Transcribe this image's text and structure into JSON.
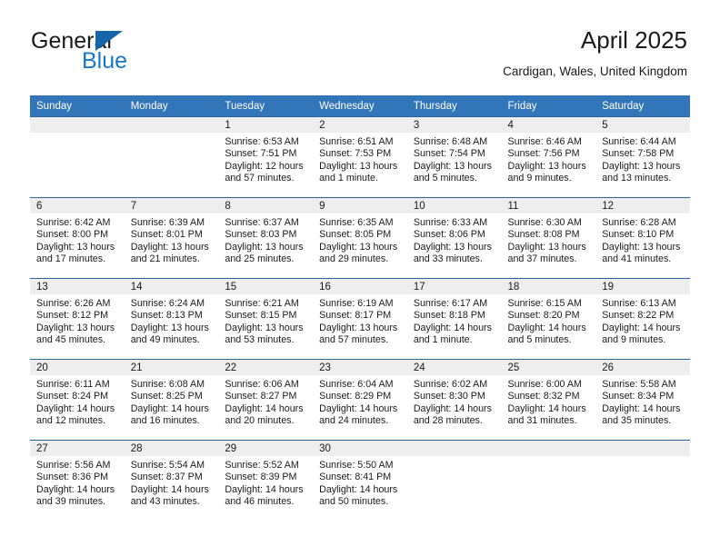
{
  "brand": {
    "name_part1": "General",
    "name_part2": "Blue",
    "accent_color": "#1878c8",
    "triangle_color": "#1565ac"
  },
  "header": {
    "title": "April 2025",
    "subtitle": "Cardigan, Wales, United Kingdom"
  },
  "theme": {
    "header_row_bg": "#3275b9",
    "cell_border": "#2b64a0",
    "daynum_band_bg": "#eeeeee"
  },
  "weekdays": [
    "Sunday",
    "Monday",
    "Tuesday",
    "Wednesday",
    "Thursday",
    "Friday",
    "Saturday"
  ],
  "weeks": [
    [
      {
        "day": "",
        "sunrise": "",
        "sunset": "",
        "daylight": ""
      },
      {
        "day": "",
        "sunrise": "",
        "sunset": "",
        "daylight": ""
      },
      {
        "day": "1",
        "sunrise": "Sunrise: 6:53 AM",
        "sunset": "Sunset: 7:51 PM",
        "daylight": "Daylight: 12 hours and 57 minutes."
      },
      {
        "day": "2",
        "sunrise": "Sunrise: 6:51 AM",
        "sunset": "Sunset: 7:53 PM",
        "daylight": "Daylight: 13 hours and 1 minute."
      },
      {
        "day": "3",
        "sunrise": "Sunrise: 6:48 AM",
        "sunset": "Sunset: 7:54 PM",
        "daylight": "Daylight: 13 hours and 5 minutes."
      },
      {
        "day": "4",
        "sunrise": "Sunrise: 6:46 AM",
        "sunset": "Sunset: 7:56 PM",
        "daylight": "Daylight: 13 hours and 9 minutes."
      },
      {
        "day": "5",
        "sunrise": "Sunrise: 6:44 AM",
        "sunset": "Sunset: 7:58 PM",
        "daylight": "Daylight: 13 hours and 13 minutes."
      }
    ],
    [
      {
        "day": "6",
        "sunrise": "Sunrise: 6:42 AM",
        "sunset": "Sunset: 8:00 PM",
        "daylight": "Daylight: 13 hours and 17 minutes."
      },
      {
        "day": "7",
        "sunrise": "Sunrise: 6:39 AM",
        "sunset": "Sunset: 8:01 PM",
        "daylight": "Daylight: 13 hours and 21 minutes."
      },
      {
        "day": "8",
        "sunrise": "Sunrise: 6:37 AM",
        "sunset": "Sunset: 8:03 PM",
        "daylight": "Daylight: 13 hours and 25 minutes."
      },
      {
        "day": "9",
        "sunrise": "Sunrise: 6:35 AM",
        "sunset": "Sunset: 8:05 PM",
        "daylight": "Daylight: 13 hours and 29 minutes."
      },
      {
        "day": "10",
        "sunrise": "Sunrise: 6:33 AM",
        "sunset": "Sunset: 8:06 PM",
        "daylight": "Daylight: 13 hours and 33 minutes."
      },
      {
        "day": "11",
        "sunrise": "Sunrise: 6:30 AM",
        "sunset": "Sunset: 8:08 PM",
        "daylight": "Daylight: 13 hours and 37 minutes."
      },
      {
        "day": "12",
        "sunrise": "Sunrise: 6:28 AM",
        "sunset": "Sunset: 8:10 PM",
        "daylight": "Daylight: 13 hours and 41 minutes."
      }
    ],
    [
      {
        "day": "13",
        "sunrise": "Sunrise: 6:26 AM",
        "sunset": "Sunset: 8:12 PM",
        "daylight": "Daylight: 13 hours and 45 minutes."
      },
      {
        "day": "14",
        "sunrise": "Sunrise: 6:24 AM",
        "sunset": "Sunset: 8:13 PM",
        "daylight": "Daylight: 13 hours and 49 minutes."
      },
      {
        "day": "15",
        "sunrise": "Sunrise: 6:21 AM",
        "sunset": "Sunset: 8:15 PM",
        "daylight": "Daylight: 13 hours and 53 minutes."
      },
      {
        "day": "16",
        "sunrise": "Sunrise: 6:19 AM",
        "sunset": "Sunset: 8:17 PM",
        "daylight": "Daylight: 13 hours and 57 minutes."
      },
      {
        "day": "17",
        "sunrise": "Sunrise: 6:17 AM",
        "sunset": "Sunset: 8:18 PM",
        "daylight": "Daylight: 14 hours and 1 minute."
      },
      {
        "day": "18",
        "sunrise": "Sunrise: 6:15 AM",
        "sunset": "Sunset: 8:20 PM",
        "daylight": "Daylight: 14 hours and 5 minutes."
      },
      {
        "day": "19",
        "sunrise": "Sunrise: 6:13 AM",
        "sunset": "Sunset: 8:22 PM",
        "daylight": "Daylight: 14 hours and 9 minutes."
      }
    ],
    [
      {
        "day": "20",
        "sunrise": "Sunrise: 6:11 AM",
        "sunset": "Sunset: 8:24 PM",
        "daylight": "Daylight: 14 hours and 12 minutes."
      },
      {
        "day": "21",
        "sunrise": "Sunrise: 6:08 AM",
        "sunset": "Sunset: 8:25 PM",
        "daylight": "Daylight: 14 hours and 16 minutes."
      },
      {
        "day": "22",
        "sunrise": "Sunrise: 6:06 AM",
        "sunset": "Sunset: 8:27 PM",
        "daylight": "Daylight: 14 hours and 20 minutes."
      },
      {
        "day": "23",
        "sunrise": "Sunrise: 6:04 AM",
        "sunset": "Sunset: 8:29 PM",
        "daylight": "Daylight: 14 hours and 24 minutes."
      },
      {
        "day": "24",
        "sunrise": "Sunrise: 6:02 AM",
        "sunset": "Sunset: 8:30 PM",
        "daylight": "Daylight: 14 hours and 28 minutes."
      },
      {
        "day": "25",
        "sunrise": "Sunrise: 6:00 AM",
        "sunset": "Sunset: 8:32 PM",
        "daylight": "Daylight: 14 hours and 31 minutes."
      },
      {
        "day": "26",
        "sunrise": "Sunrise: 5:58 AM",
        "sunset": "Sunset: 8:34 PM",
        "daylight": "Daylight: 14 hours and 35 minutes."
      }
    ],
    [
      {
        "day": "27",
        "sunrise": "Sunrise: 5:56 AM",
        "sunset": "Sunset: 8:36 PM",
        "daylight": "Daylight: 14 hours and 39 minutes."
      },
      {
        "day": "28",
        "sunrise": "Sunrise: 5:54 AM",
        "sunset": "Sunset: 8:37 PM",
        "daylight": "Daylight: 14 hours and 43 minutes."
      },
      {
        "day": "29",
        "sunrise": "Sunrise: 5:52 AM",
        "sunset": "Sunset: 8:39 PM",
        "daylight": "Daylight: 14 hours and 46 minutes."
      },
      {
        "day": "30",
        "sunrise": "Sunrise: 5:50 AM",
        "sunset": "Sunset: 8:41 PM",
        "daylight": "Daylight: 14 hours and 50 minutes."
      },
      {
        "day": "",
        "sunrise": "",
        "sunset": "",
        "daylight": ""
      },
      {
        "day": "",
        "sunrise": "",
        "sunset": "",
        "daylight": ""
      },
      {
        "day": "",
        "sunrise": "",
        "sunset": "",
        "daylight": ""
      }
    ]
  ]
}
